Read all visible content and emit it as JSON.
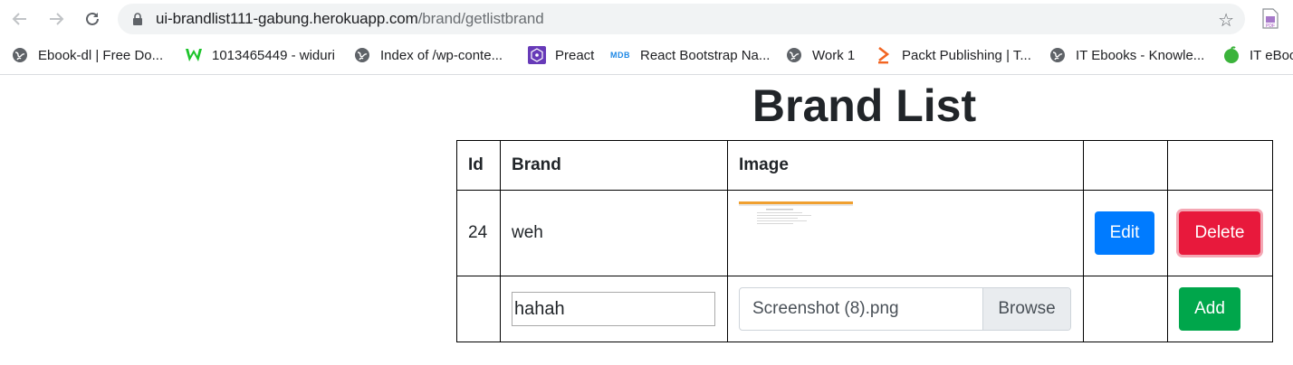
{
  "browser": {
    "url_host": "ui-brandlist111-gabung.herokuapp.com",
    "url_path": "/brand/getlistbrand",
    "bookmarks": [
      {
        "label": "Ebook-dl | Free Do...",
        "icon": "globe-icon"
      },
      {
        "label": "1013465449 - widuri",
        "icon": "wattpad-w-icon"
      },
      {
        "label": "Index of /wp-conte...",
        "icon": "globe-icon"
      },
      {
        "label": "Preact",
        "icon": "preact-icon"
      },
      {
        "label": "React Bootstrap Na...",
        "icon": "mdb-icon"
      },
      {
        "label": "Work 1",
        "icon": "globe-icon"
      },
      {
        "label": "Packt Publishing | T...",
        "icon": "packt-icon"
      },
      {
        "label": "IT Ebooks - Knowle...",
        "icon": "globe-icon"
      },
      {
        "label": "IT eBoo",
        "icon": "green-ball-icon"
      }
    ],
    "mdb_text": "MDB"
  },
  "page": {
    "title": "Brand List",
    "table": {
      "headers": [
        "Id",
        "Brand",
        "Image",
        "",
        ""
      ],
      "rows": [
        {
          "id": "24",
          "brand": "weh",
          "edit_label": "Edit",
          "delete_label": "Delete"
        }
      ],
      "new_row": {
        "brand_value": "hahah",
        "file_name": "Screenshot (8).png",
        "browse_label": "Browse",
        "add_label": "Add"
      }
    }
  },
  "colors": {
    "edit": "#007bff",
    "delete": "#e8193c",
    "add": "#00a64b"
  }
}
